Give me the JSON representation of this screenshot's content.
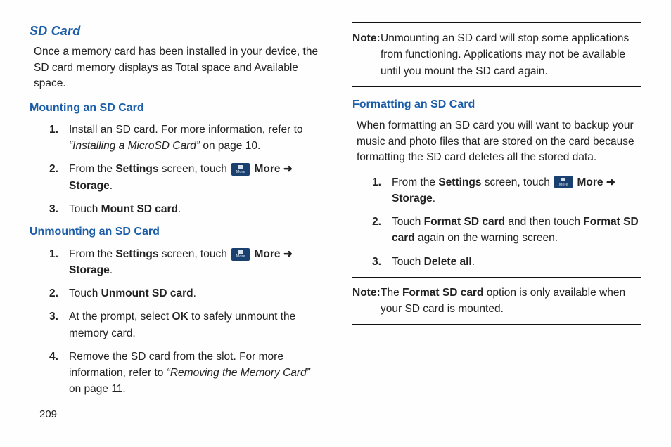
{
  "pageNumber": "209",
  "left": {
    "title": "SD Card",
    "intro": "Once a memory card has been installed in your device, the SD card memory displays as Total space and Available space.",
    "mount": {
      "heading": "Mounting an SD Card",
      "step1_a": "Install an SD card. For more information, refer to ",
      "step1_b": "“Installing a MicroSD Card”",
      "step1_c": "  on page 10.",
      "step2_a": "From the ",
      "step2_b": "Settings",
      "step2_c": " screen, touch ",
      "step2_d": "More",
      "step2_e": " ➜ ",
      "step2_f": "Storage",
      "step2_g": ".",
      "step3_a": "Touch ",
      "step3_b": "Mount SD card",
      "step3_c": "."
    },
    "unmount": {
      "heading": "Unmounting an SD Card",
      "step1_a": "From the ",
      "step1_b": "Settings",
      "step1_c": " screen, touch ",
      "step1_d": "More",
      "step1_e": " ➜ ",
      "step1_f": "Storage",
      "step1_g": ".",
      "step2_a": "Touch ",
      "step2_b": "Unmount SD card",
      "step2_c": ".",
      "step3_a": "At the prompt, select ",
      "step3_b": "OK",
      "step3_c": " to safely unmount the memory card.",
      "step4_a": "Remove the SD card from the slot. For more information, refer to ",
      "step4_b": "“Removing the Memory Card”",
      "step4_c": "  on page 11."
    }
  },
  "right": {
    "note1": {
      "label": "Note:",
      "text": " Unmounting an SD card will stop some applications from functioning. Applications may not be available until you mount the SD card again."
    },
    "format": {
      "heading": "Formatting an SD Card",
      "intro": "When formatting an SD card you will want to backup your music and photo files that are stored on the card because formatting the SD card deletes all the stored data.",
      "step1_a": "From the ",
      "step1_b": "Settings",
      "step1_c": " screen, touch ",
      "step1_d": "More",
      "step1_e": " ➜ ",
      "step1_f": "Storage",
      "step1_g": ".",
      "step2_a": "Touch ",
      "step2_b": "Format SD card",
      "step2_c": " and then touch ",
      "step2_d": "Format SD card",
      "step2_e": " again on the warning screen.",
      "step3_a": "Touch ",
      "step3_b": "Delete all",
      "step3_c": "."
    },
    "note2": {
      "label": "Note:",
      "text_a": " The ",
      "text_b": "Format SD card",
      "text_c": " option is only available when your SD card is mounted."
    }
  }
}
